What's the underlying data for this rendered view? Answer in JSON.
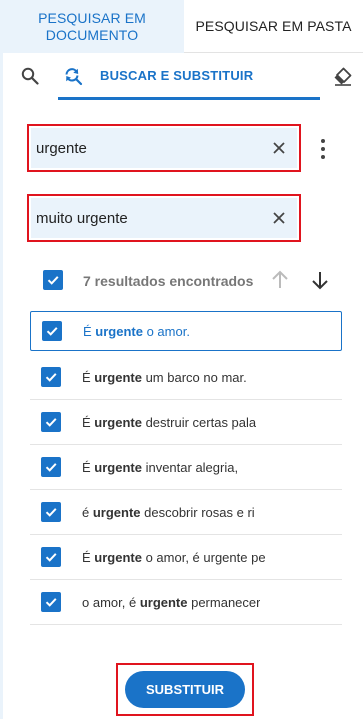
{
  "tabs": {
    "search_in_document": "PESQUISAR EM DOCUMENTO",
    "search_in_folder": "PESQUISAR EM PASTA"
  },
  "toolbar": {
    "active_mode_label": "BUSCAR E SUBSTITUIR",
    "icons": [
      "search-icon",
      "find-replace-icon",
      "eraser-icon"
    ]
  },
  "find": {
    "value": "urgente"
  },
  "replace": {
    "value": "muito urgente"
  },
  "results": {
    "count_label": "7 resultados encontrados",
    "all_checked": true,
    "items": [
      {
        "pre": "É ",
        "match": "urgente",
        "post": " o amor.",
        "checked": true,
        "selected": true
      },
      {
        "pre": "É ",
        "match": "urgente",
        "post": " um barco no mar.",
        "checked": true,
        "selected": false
      },
      {
        "pre": "É ",
        "match": "urgente",
        "post": " destruir certas pala",
        "checked": true,
        "selected": false
      },
      {
        "pre": "É ",
        "match": "urgente",
        "post": " inventar alegria,",
        "checked": true,
        "selected": false
      },
      {
        "pre": "é ",
        "match": "urgente",
        "post": " descobrir rosas e ri",
        "checked": true,
        "selected": false
      },
      {
        "pre": "É ",
        "match": "urgente",
        "post": " o amor, é urgente pe",
        "checked": true,
        "selected": false
      },
      {
        "pre": "o amor, é ",
        "match": "urgente",
        "post": " permanecer",
        "checked": true,
        "selected": false
      }
    ]
  },
  "actions": {
    "replace_label": "SUBSTITUIR"
  },
  "colors": {
    "accent": "#1a73c8",
    "highlight_frame": "#e0141e",
    "tab_active_bg": "#eaf3fb"
  }
}
